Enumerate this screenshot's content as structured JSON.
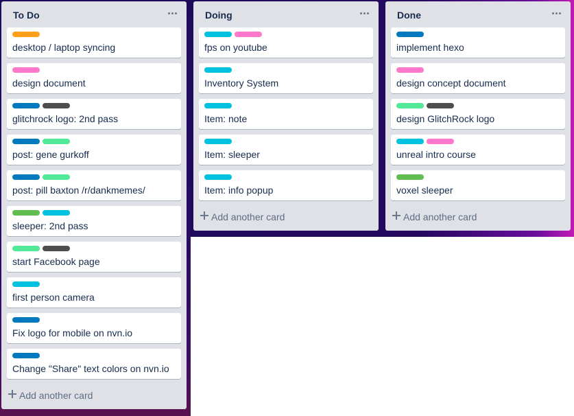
{
  "colors": {
    "orange": "#ff9f1a",
    "pink": "#ff78cb",
    "blue": "#0079bf",
    "black": "#4d4d4d",
    "lime": "#51e898",
    "green": "#61bd4f",
    "sky": "#00c2e0"
  },
  "lists": [
    {
      "title": "To Do",
      "menu_icon": "ellipsis-icon",
      "add_label": "Add another card",
      "cards": [
        {
          "title": "desktop / laptop syncing",
          "labels": [
            "orange"
          ]
        },
        {
          "title": "design document",
          "labels": [
            "pink"
          ]
        },
        {
          "title": "glitchrock logo: 2nd pass",
          "labels": [
            "blue",
            "black"
          ]
        },
        {
          "title": "post: gene gurkoff",
          "labels": [
            "blue",
            "lime"
          ]
        },
        {
          "title": "post: pill baxton /r/dankmemes/",
          "labels": [
            "blue",
            "lime"
          ]
        },
        {
          "title": "sleeper: 2nd pass",
          "labels": [
            "green",
            "sky"
          ]
        },
        {
          "title": "start Facebook page",
          "labels": [
            "lime",
            "black"
          ]
        },
        {
          "title": "first person camera",
          "labels": [
            "sky"
          ]
        },
        {
          "title": "Fix logo for mobile on nvn.io",
          "labels": [
            "blue"
          ]
        },
        {
          "title": "Change \"Share\" text colors on nvn.io",
          "labels": [
            "blue"
          ]
        }
      ]
    },
    {
      "title": "Doing",
      "menu_icon": "ellipsis-icon",
      "add_label": "Add another card",
      "cards": [
        {
          "title": "fps on youtube",
          "labels": [
            "sky",
            "pink"
          ]
        },
        {
          "title": "Inventory System",
          "labels": [
            "sky"
          ]
        },
        {
          "title": "Item: note",
          "labels": [
            "sky"
          ]
        },
        {
          "title": "Item: sleeper",
          "labels": [
            "sky"
          ]
        },
        {
          "title": "Item: info popup",
          "labels": [
            "sky"
          ]
        }
      ]
    },
    {
      "title": "Done",
      "menu_icon": "ellipsis-icon",
      "add_label": "Add another card",
      "cards": [
        {
          "title": "implement hexo",
          "labels": [
            "blue"
          ]
        },
        {
          "title": "design concept document",
          "labels": [
            "pink"
          ]
        },
        {
          "title": "design GlitchRock logo",
          "labels": [
            "lime",
            "black"
          ]
        },
        {
          "title": "unreal intro course",
          "labels": [
            "sky",
            "pink"
          ]
        },
        {
          "title": "voxel sleeper",
          "labels": [
            "green"
          ]
        }
      ]
    }
  ]
}
